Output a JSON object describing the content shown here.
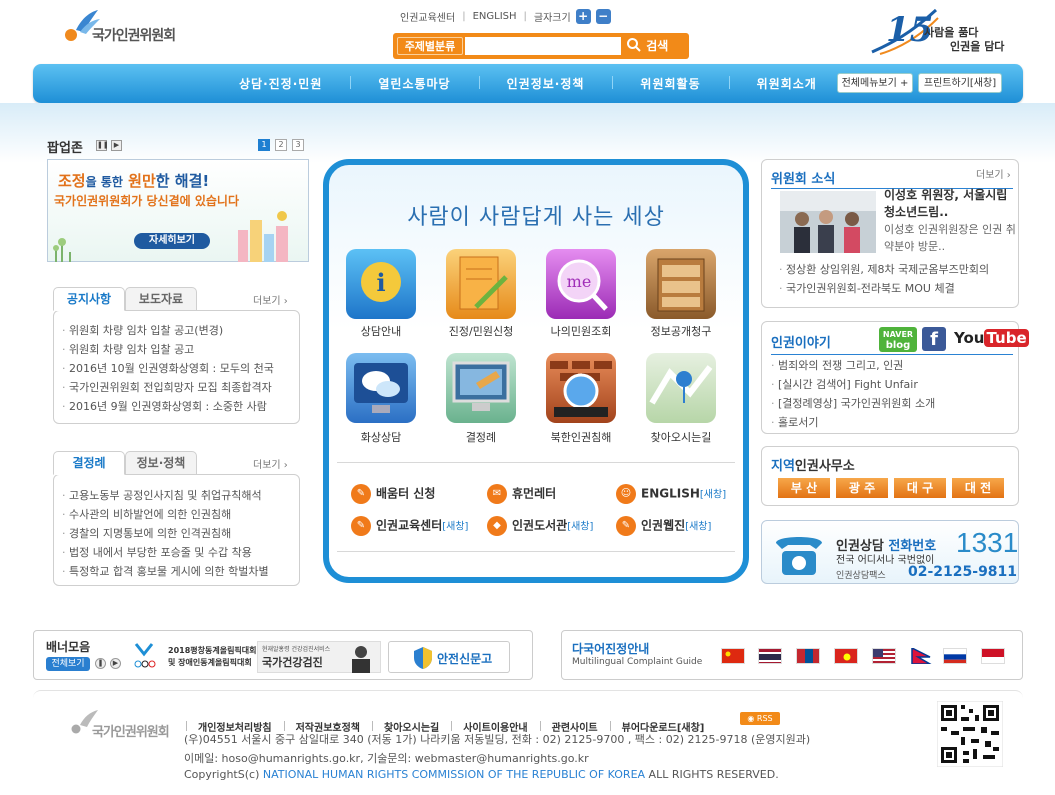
{
  "header": {
    "logo_text": "국가인권위원회",
    "top_links": [
      "인권교육센터",
      "ENGLISH",
      "글자크기"
    ],
    "font_plus": "+",
    "font_minus": "−",
    "search_category": "주제별분류",
    "search_button": "검색",
    "anniversary_number": "15",
    "anniversary_line1": "사람을 품다",
    "anniversary_line2": "인권을 담다"
  },
  "nav": {
    "items": [
      "상담·진정·민원",
      "열린소통마당",
      "인권정보·정책",
      "위원회활동",
      "위원회소개"
    ],
    "all_menu": "전체메뉴보기 +",
    "print": "프린트하기[새창]"
  },
  "popup": {
    "title": "팝업존",
    "pages": [
      "1",
      "2",
      "3"
    ],
    "banner_line1a": "조정",
    "banner_line1b": "을 통한",
    "banner_line1c": "원만",
    "banner_line1d": "한 해결!",
    "banner_line2a": "국가인권위원회",
    "banner_line2b": "가 당신곁에 있습니다",
    "banner_button": "자세히보기"
  },
  "notice": {
    "tab1": "공지사항",
    "tab2": "보도자료",
    "more": "더보기",
    "items": [
      "위원회 차량 임차 입찰 공고(변경)",
      "위원회 차량 임차 입찰 공고",
      "2016년 10월 인권영화상영회 : 모두의 천국",
      "국가인권위원회 전입희망자 모집 최종합격자",
      "2016년 9월 인권영화상영회 : 소중한 사람"
    ]
  },
  "decision": {
    "tab1": "결정례",
    "tab2": "정보·정책",
    "more": "더보기",
    "items": [
      "고용노동부 공정인사지침 및 취업규칙해석",
      "수사관의 비하발언에 의한 인권침해",
      "경찰의 지명통보에 의한 인격권침해",
      "법정 내에서 부당한 포승줄 및 수갑 착용",
      "특정학교 합격 홍보물 게시에 의한 학벌차별"
    ]
  },
  "center": {
    "slogan": "사람이 사람답게 사는 세상",
    "icons": [
      "상담안내",
      "진정/민원신청",
      "나의민원조회",
      "정보공개청구",
      "화상상담",
      "결정례",
      "북한인권침해",
      "찾아오시는길"
    ],
    "icon_me": "me",
    "quick": [
      {
        "label": "배움터 신청",
        "new": ""
      },
      {
        "label": "휴먼레터",
        "new": ""
      },
      {
        "label": "ENGLISH",
        "new": "[새창]"
      },
      {
        "label": "인권교육센터",
        "new": "[새창]"
      },
      {
        "label": "인권도서관",
        "new": "[새창]"
      },
      {
        "label": "인권웹진",
        "new": "[새창]"
      }
    ]
  },
  "news": {
    "title": "위원회 소식",
    "more": "더보기",
    "headline": "이성호 위원장, 서울시립청소년드림..",
    "summary": "이성호 인권위원장은 인권 취약분야 방문..",
    "items": [
      "정상환 상임위원, 제8차 국제군옴부즈만회의",
      "국가인권위원회-전라북도 MOU 체결"
    ]
  },
  "story": {
    "title": "인권이야기",
    "naver1": "NAVER",
    "naver2": "blog",
    "facebook": "f",
    "youtube_you": "You",
    "youtube_tube": "Tube",
    "items": [
      "범죄와의 전쟁 그리고, 인권",
      "[실시간 검색어] Fight Unfair",
      "[결정례영상] 국가인권위원회 소개",
      "홀로서기"
    ]
  },
  "office": {
    "title_a": "지역",
    "title_b": "인권사무소",
    "cities": [
      "부 산",
      "광 주",
      "대 구",
      "대 전"
    ]
  },
  "hotline": {
    "title_a": "인권상담",
    "title_b": "전화번호",
    "number": "1331",
    "sub": "전국 어디서나 국번없이",
    "fax_label": "인권상담팩스",
    "fax": "02-2125-9811"
  },
  "banners": {
    "title": "배너모음",
    "view_all": "전체보기",
    "olympics1": "2018평창동계올림픽대회",
    "olympics2": "및 장애인동계올림픽대회",
    "health_top": "현재알홍령 건강검진서비스",
    "health": "국가건강검진",
    "safety": "안전신문고"
  },
  "multilingual": {
    "title": "다국어진정안내",
    "sub": "Multilingual Complaint Guide"
  },
  "footer": {
    "logo_text": "국가인권위원회",
    "links": [
      "개인정보처리방침",
      "저작권보호정책",
      "찾아오시는길",
      "사이트이용안내",
      "관련사이트",
      "뷰어다운로드[새창]"
    ],
    "rss": "RSS",
    "address": "(우)04551 서울시 중구 삼일대로 340 (저동 1가) 나라키움 저동빌딩, 전화 : 02) 2125-9700 , 팩스 : 02) 2125-9718 (운영지원과)",
    "email": "이메일: hoso@humanrights.go.kr, 기술문의: webmaster@humanrights.go.kr",
    "copyright_a": "CopyrightS(c)",
    "copyright_b": "NATIONAL HUMAN RIGHTS COMMISSION OF THE REPUBLIC OF KOREA",
    "copyright_c": "ALL RIGHTS RESERVED."
  },
  "colors": {
    "accent": "#1e8fd6",
    "orange": "#f28a18"
  }
}
